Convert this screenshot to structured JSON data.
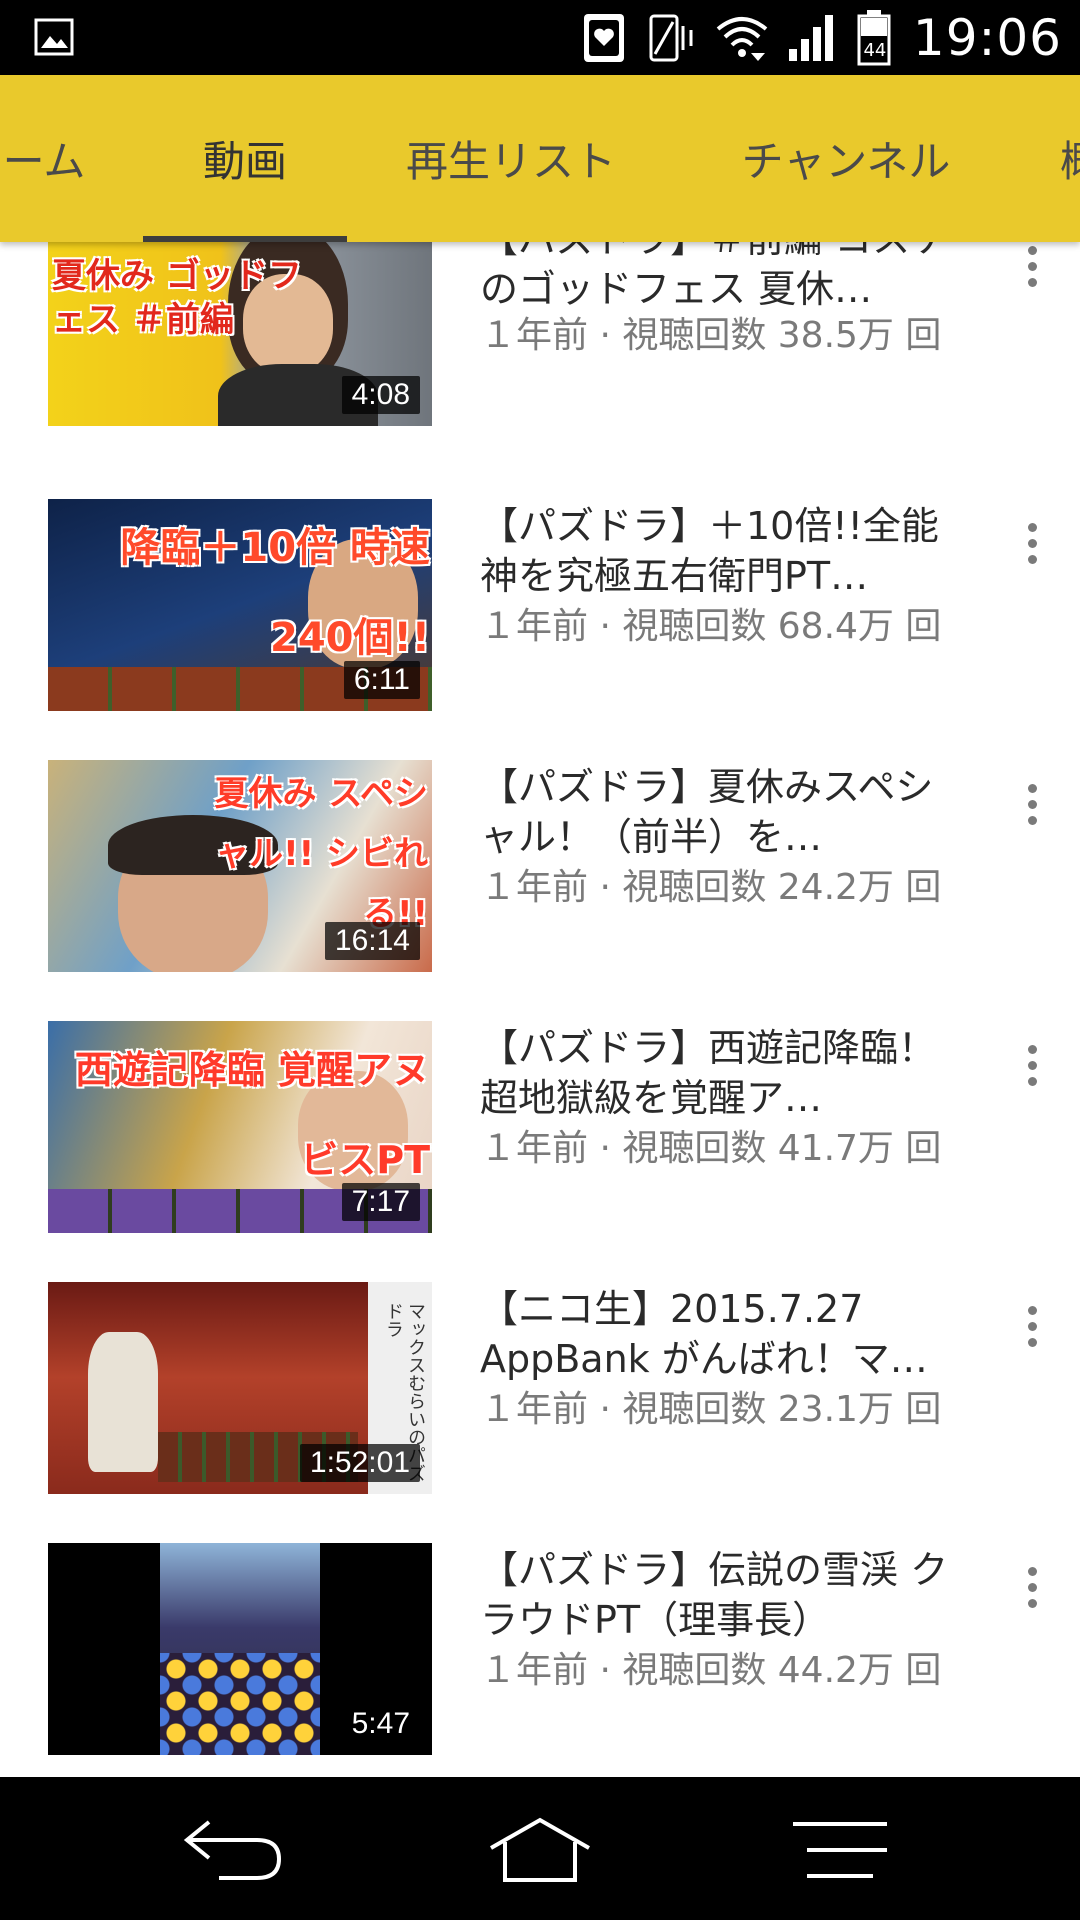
{
  "status_bar": {
    "time": "19:06",
    "battery_level": "44",
    "icons": [
      "image-icon",
      "smartwatch-icon",
      "vibrate-icon",
      "wifi-icon",
      "signal-icon",
      "battery-icon"
    ]
  },
  "tabs": [
    {
      "label": "ーム",
      "active": false
    },
    {
      "label": "動画",
      "active": true
    },
    {
      "label": "再生リスト",
      "active": false
    },
    {
      "label": "チャンネル",
      "active": false
    },
    {
      "label": "概",
      "active": false
    }
  ],
  "videos": [
    {
      "title": "【パズドラ】＃前編 コスケのゴッドフェス 夏休…",
      "meta": "１年前 · 視聴回数 38.5万 回",
      "duration": "4:08",
      "thumb_text": "夏休み ゴッドフェス ＃前編"
    },
    {
      "title": "【パズドラ】＋10倍!!全能神を究極五右衛門PT…",
      "meta": "１年前 · 視聴回数 68.4万 回",
      "duration": "6:11",
      "thumb_text": "降臨＋10倍 時速240個!!"
    },
    {
      "title": "【パズドラ】夏休みスペシャル！（前半）を…",
      "meta": "１年前 · 視聴回数 24.2万 回",
      "duration": "16:14",
      "thumb_text": "夏休み スペシャル!! シビれる!!"
    },
    {
      "title": "【パズドラ】西遊記降臨！ 超地獄級を覚醒ア…",
      "meta": "１年前 · 視聴回数 41.7万 回",
      "duration": "7:17",
      "thumb_text": "西遊記降臨 覚醒アヌビスPT"
    },
    {
      "title": "【ニコ生】2015.7.27 AppBank がんばれ！マ…",
      "meta": "１年前 · 視聴回数 23.1万 回",
      "duration": "1:52:01",
      "thumb_text": "マックスむらいのパズドラ"
    },
    {
      "title": "【パズドラ】伝説の雪渓 クラウドPT（理事長）",
      "meta": "１年前 · 視聴回数 44.2万 回",
      "duration": "5:47",
      "thumb_text": ""
    }
  ],
  "colors": {
    "tab_bar": "#e9c92c",
    "status_bar": "#000000",
    "nav_bar": "#000000",
    "title_text": "#2a2a2a",
    "meta_text": "#7a7a7a"
  },
  "nav_bar": {
    "icons": [
      "back-icon",
      "home-icon",
      "menu-icon"
    ]
  }
}
